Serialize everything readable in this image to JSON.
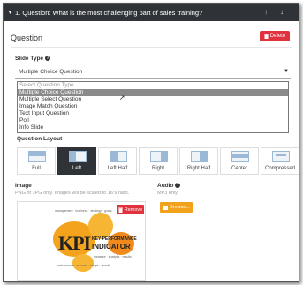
{
  "question_bar": {
    "title": "1. Question: What is the most challenging part of sales training?",
    "caret": "▾",
    "up_arrow": "↑",
    "down_arrow": "↓"
  },
  "header": {
    "title": "Question",
    "delete_label": "Delete",
    "delete_icon": "trash-icon"
  },
  "slide_type": {
    "label": "Slide Type",
    "selected": "Multiple Choice Question",
    "options": [
      "Select Question Type",
      "Multiple Choice Question",
      "Multiple Select Question",
      "Image Match Question",
      "Text Input Question",
      "Poll",
      "Info Slide"
    ],
    "highlighted_index": 1
  },
  "question_layout": {
    "label": "Question Layout",
    "items": [
      {
        "label": "Full",
        "active": false
      },
      {
        "label": "Left",
        "active": true
      },
      {
        "label": "Left Half",
        "active": false
      },
      {
        "label": "Right",
        "active": false
      },
      {
        "label": "Right Half",
        "active": false
      },
      {
        "label": "Center",
        "active": false
      },
      {
        "label": "Compressed",
        "active": false
      }
    ]
  },
  "image": {
    "label": "Image",
    "hint": "PNG or JPG only. Images will be scaled to 16:9 ratio.",
    "remove_label": "Remove",
    "kpi_big": "KPI",
    "kpi_line1": "KEY PERFORMANCE",
    "kpi_line2": "INDICATOR"
  },
  "audio": {
    "label": "Audio",
    "hint": "MP3 only.",
    "browse_label": "Browse..."
  },
  "colors": {
    "bar": "#2f3338",
    "danger": "#e0313d",
    "warning": "#f0a21b",
    "selected_option": "#8a8a8a"
  }
}
